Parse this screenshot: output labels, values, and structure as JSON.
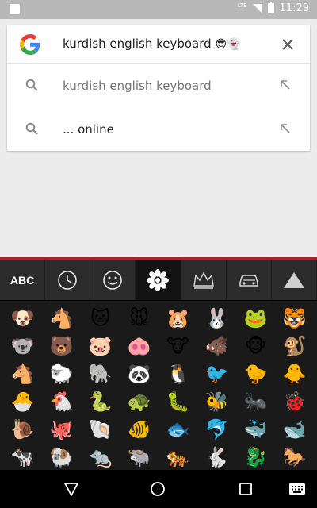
{
  "status_bar": {
    "network_label": "LTE",
    "time": "11:29"
  },
  "search": {
    "query": "kurdish english keyboard",
    "query_emoji": "😎👻",
    "suggestions": [
      {
        "text": "kurdish english keyboard",
        "style": "gray"
      },
      {
        "text": "... online",
        "style": "dark"
      }
    ],
    "icons": {
      "clear": "close-icon",
      "search": "search-icon",
      "fill": "arrow-up-left-icon"
    }
  },
  "keyboard": {
    "tabs": [
      {
        "label": "ABC",
        "icon": "abc-text"
      },
      {
        "label": "",
        "icon": "clock-icon"
      },
      {
        "label": "",
        "icon": "smiley-icon"
      },
      {
        "label": "",
        "icon": "flower-icon",
        "active": true
      },
      {
        "label": "",
        "icon": "crown-icon"
      },
      {
        "label": "",
        "icon": "car-icon"
      },
      {
        "label": "",
        "icon": "triangle-icon"
      }
    ],
    "emojis": [
      [
        "🐶",
        "🐴",
        "🐱",
        "🐭",
        "🐹",
        "🐰",
        "🐸",
        "🐯"
      ],
      [
        "🐨",
        "🐻",
        "🐷",
        "🐽",
        "🐮",
        "🐗",
        "🐵",
        "🐒"
      ],
      [
        "🐴",
        "🐑",
        "🐘",
        "🐼",
        "🐧",
        "🐦",
        "🐤",
        "🐥"
      ],
      [
        "🐣",
        "🐔",
        "🐍",
        "🐢",
        "🐛",
        "🐝",
        "🐜",
        "🐞"
      ],
      [
        "🐌",
        "🐙",
        "🐚",
        "🐠",
        "🐟",
        "🐬",
        "🐳",
        "🐋"
      ],
      [
        "🐄",
        "🐏",
        "🐀",
        "🐃",
        "🐅",
        "🐇",
        "🐉",
        "🐎"
      ]
    ]
  },
  "colors": {
    "keyboard_bg": "#1a1a1a",
    "keyboard_accent": "#b21f2b",
    "status_bar": "#b8b8b8"
  }
}
